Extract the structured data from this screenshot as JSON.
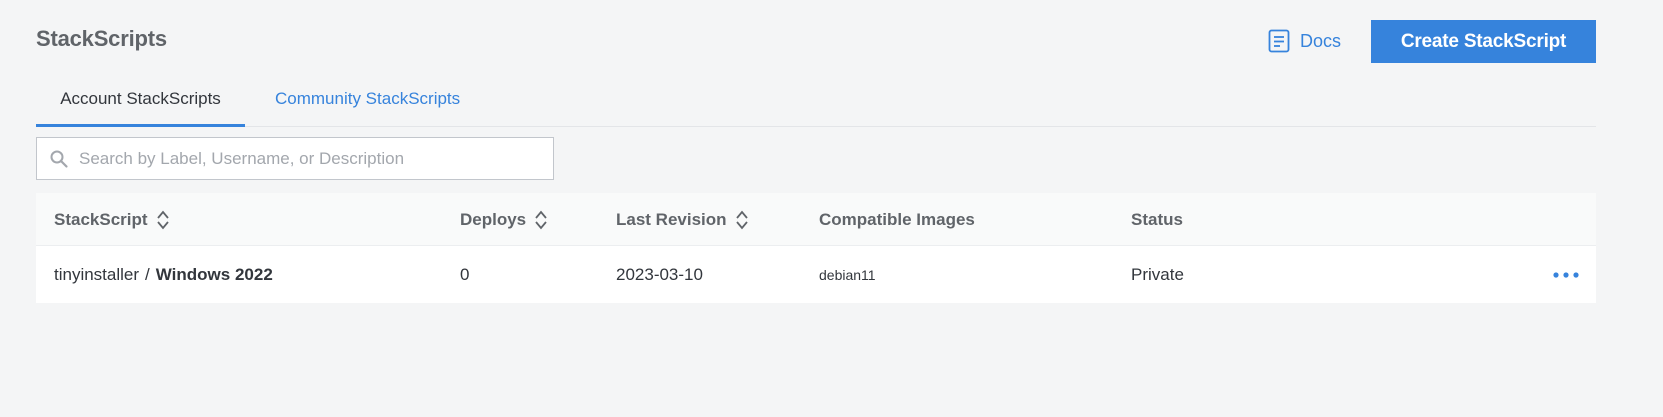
{
  "header": {
    "title": "StackScripts",
    "docs_label": "Docs",
    "create_label": "Create StackScript"
  },
  "tabs": [
    {
      "label": "Account StackScripts",
      "active": true
    },
    {
      "label": "Community StackScripts",
      "active": false
    }
  ],
  "search": {
    "placeholder": "Search by Label, Username, or Description",
    "value": ""
  },
  "table": {
    "columns": [
      {
        "label": "StackScript",
        "sortable": true
      },
      {
        "label": "Deploys",
        "sortable": true
      },
      {
        "label": "Last Revision",
        "sortable": true
      },
      {
        "label": "Compatible Images",
        "sortable": false
      },
      {
        "label": "Status",
        "sortable": false
      }
    ],
    "rows": [
      {
        "owner": "tinyinstaller",
        "separator": "/",
        "label": "Windows 2022",
        "deploys": "0",
        "last_revision": "2023-03-10",
        "images": "debian11",
        "status": "Private"
      }
    ]
  },
  "colors": {
    "accent": "#3683dc",
    "background": "#f4f5f6",
    "title_text": "#606469"
  },
  "icons": {
    "docs": "document-icon",
    "search": "search-icon",
    "sort": "sort-icon",
    "more": "more-horizontal-icon"
  }
}
